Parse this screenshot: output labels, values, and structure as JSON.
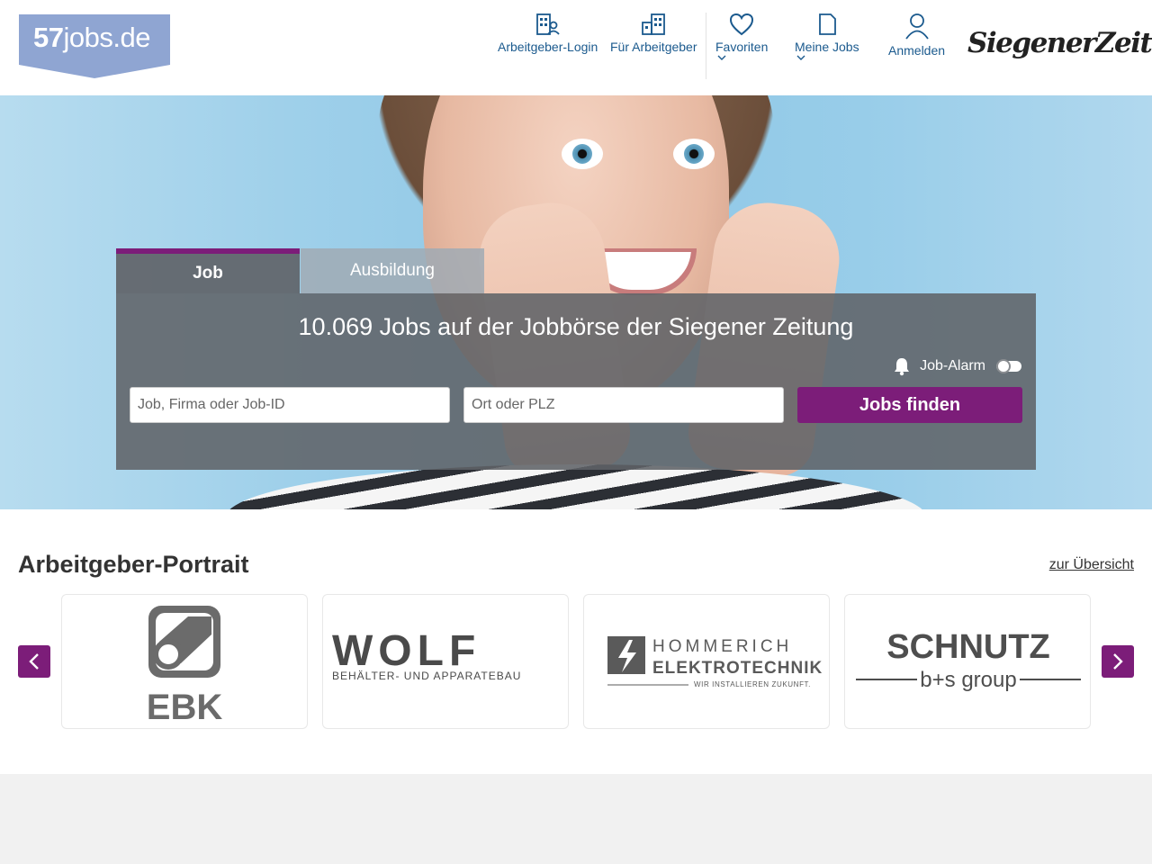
{
  "header": {
    "logo_bold": "57",
    "logo_rest": "jobs.de",
    "nav": [
      {
        "label": "Arbeitgeber-Login",
        "icon": "employer-login-icon"
      },
      {
        "label": "Für Arbeitgeber",
        "icon": "building-icon"
      },
      {
        "label": "Favoriten",
        "icon": "heart-icon"
      },
      {
        "label": "Meine Jobs",
        "icon": "document-icon"
      },
      {
        "label": "Anmelden",
        "icon": "user-icon"
      }
    ],
    "partner_logo": "SiegenerZeitung"
  },
  "search": {
    "tabs": [
      "Job",
      "Ausbildung"
    ],
    "active_tab": "Job",
    "title": "10.069 Jobs auf der Jobbörse der Siegener Zeitung",
    "job_alarm_label": "Job-Alarm",
    "job_alarm_on": false,
    "what_placeholder": "Job, Firma oder Job-ID",
    "where_placeholder": "Ort oder PLZ",
    "submit_label": "Jobs finden"
  },
  "portraits": {
    "title": "Arbeitgeber-Portrait",
    "overview_link": "zur Übersicht",
    "cards": [
      {
        "name": "EBK"
      },
      {
        "name": "WOLF",
        "tagline": "BEHÄLTER- UND APPARATEBAU"
      },
      {
        "name_top": "HOMMERICH",
        "name_bottom": "ELEKTROTECHNIK",
        "tagline": "WIR INSTALLIEREN ZUKUNFT."
      },
      {
        "name": "SCHNUTZ",
        "tagline": "b+s group"
      }
    ]
  },
  "colors": {
    "brand_purple": "#7c1d79",
    "nav_blue": "#1b5a8e",
    "logo_bg": "#8fa5d2"
  }
}
